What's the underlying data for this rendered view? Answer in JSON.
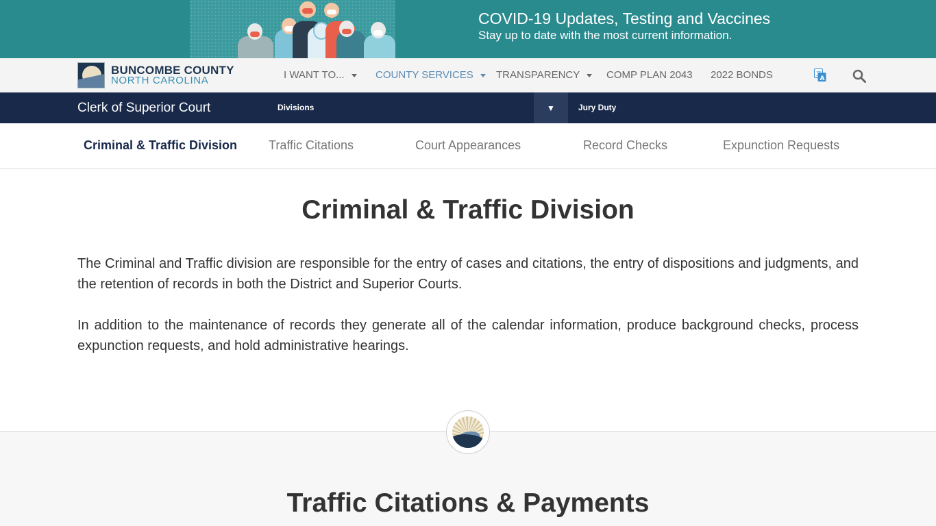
{
  "banner": {
    "title": "COVID-19 Updates, Testing and Vaccines",
    "subtitle": "Stay up to date with the most current information."
  },
  "brand": {
    "line1": "BUNCOMBE COUNTY",
    "line2": "NORTH CAROLINA"
  },
  "nav": {
    "items": [
      {
        "label": "I WANT TO...",
        "dropdown": true
      },
      {
        "label": "COUNTY SERVICES",
        "dropdown": true,
        "active": true
      },
      {
        "label": "TRANSPARENCY",
        "dropdown": true
      },
      {
        "label": "COMP PLAN 2043",
        "dropdown": false
      },
      {
        "label": "2022 BONDS",
        "dropdown": false
      }
    ],
    "icons": [
      "translate-icon",
      "search-icon"
    ]
  },
  "department": {
    "title": "Clerk of Superior Court",
    "divisions_label": "Divisions",
    "toggle_glyph": "▼",
    "jury_label": "Jury Duty"
  },
  "subtabs": [
    {
      "label": "Criminal & Traffic Division",
      "active": true
    },
    {
      "label": "Traffic Citations"
    },
    {
      "label": "Court Appearances"
    },
    {
      "label": "Record Checks"
    },
    {
      "label": "Expunction Requests"
    }
  ],
  "content": {
    "title": "Criminal & Traffic Division",
    "paragraphs": [
      "The Criminal and Traffic division are responsible for the entry of cases and citations, the entry of dispositions and judgments, and the retention of records in both the District and Superior Courts.",
      "In addition to the maintenance of records they generate all of the calendar information, produce background checks, process expunction requests, and hold administrative hearings."
    ]
  },
  "section2": {
    "title": "Traffic Citations & Payments"
  },
  "colors": {
    "banner": "#2a8b8f",
    "dept_bar": "#18294a",
    "nav_active": "#5b8bb5",
    "brand_navy": "#1e3550",
    "brand_teal": "#3a8fb0"
  }
}
